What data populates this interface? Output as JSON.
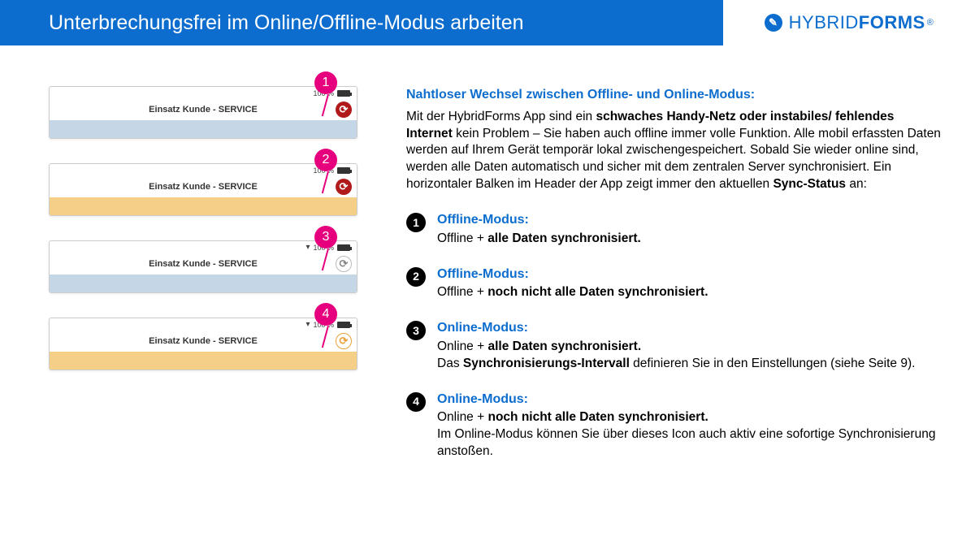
{
  "header": {
    "title": "Unterbrechungsfrei im Online/Offline-Modus arbeiten"
  },
  "logo": {
    "light": "HYBRID",
    "bold": "FORMS",
    "reg": "®"
  },
  "examples": [
    {
      "num": "1",
      "battery": "100 %",
      "title": "Einsatz Kunde - SERVICE",
      "wifi": false,
      "syncVariant": "red",
      "barVariant": "blue"
    },
    {
      "num": "2",
      "battery": "100 %",
      "title": "Einsatz Kunde - SERVICE",
      "wifi": false,
      "syncVariant": "red",
      "barVariant": "orange"
    },
    {
      "num": "3",
      "battery": "100 %",
      "title": "Einsatz Kunde - SERVICE",
      "wifi": true,
      "syncVariant": "gray",
      "barVariant": "blue"
    },
    {
      "num": "4",
      "battery": "100 %",
      "title": "Einsatz Kunde - SERVICE",
      "wifi": true,
      "syncVariant": "orange",
      "barVariant": "orange"
    }
  ],
  "intro": {
    "heading": "Nahtloser Wechsel zwischen Offline- und Online-Modus:",
    "p1a": "Mit der HybridForms App sind ein ",
    "p1b": "schwaches Handy-Netz oder instabiles/ fehlendes Internet",
    "p1c": " kein Problem – Sie haben auch offline immer volle Funktion. Alle mobil erfassten Daten werden auf Ihrem Gerät temporär lokal zwischengespeichert. Sobald Sie wieder online sind, werden alle Daten automatisch und sicher mit dem zentralen Server synchronisiert. Ein horizontaler Balken im Header der App zeigt immer den aktuellen ",
    "p1d": "Sync-Status",
    "p1e": " an:"
  },
  "items": [
    {
      "num": "1",
      "title": "Offline-Modus:",
      "line1a": "Offline + ",
      "line1b": "alle Daten synchronisiert.",
      "extra1a": "",
      "extra1b": "",
      "extra1c": ""
    },
    {
      "num": "2",
      "title": "Offline-Modus:",
      "line1a": "Offline + ",
      "line1b": "noch nicht alle Daten synchronisiert.",
      "extra1a": "",
      "extra1b": "",
      "extra1c": ""
    },
    {
      "num": "3",
      "title": "Online-Modus:",
      "line1a": "Online + ",
      "line1b": "alle Daten synchronisiert.",
      "extra1a": "Das ",
      "extra1b": "Synchronisierungs-Intervall",
      "extra1c": " definieren Sie in den Einstellungen (siehe Seite 9)."
    },
    {
      "num": "4",
      "title": "Online-Modus:",
      "line1a": "Online + ",
      "line1b": "noch nicht alle Daten synchronisiert.",
      "extra1a": "Im Online-Modus können Sie über dieses Icon auch aktiv eine sofortige Synchronisierung anstoßen.",
      "extra1b": "",
      "extra1c": ""
    }
  ]
}
